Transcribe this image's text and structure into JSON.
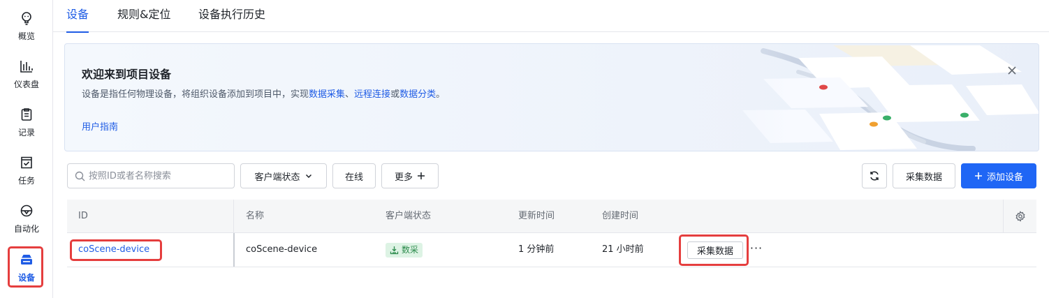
{
  "sidebar": {
    "items": [
      {
        "label": "概览",
        "icon": "lightbulb-icon"
      },
      {
        "label": "仪表盘",
        "icon": "bar-chart-icon"
      },
      {
        "label": "记录",
        "icon": "clipboard-icon"
      },
      {
        "label": "任务",
        "icon": "task-check-icon"
      },
      {
        "label": "自动化",
        "icon": "automation-icon"
      },
      {
        "label": "设备",
        "icon": "device-icon",
        "active": true
      }
    ]
  },
  "tabs": [
    {
      "label": "设备",
      "active": true
    },
    {
      "label": "规则&定位"
    },
    {
      "label": "设备执行历史"
    }
  ],
  "banner": {
    "title": "欢迎来到项目设备",
    "desc_prefix": "设备是指任何物理设备，将组织设备添加到项目中，实现",
    "link_data_collect": "数据采集",
    "sep1": "、",
    "link_remote": "远程连接",
    "sep2": "或",
    "link_classify": "数据分类",
    "desc_suffix": "。",
    "guide": "用户指南",
    "close_icon": "close-icon"
  },
  "toolbar": {
    "search_placeholder": "按照ID或者名称搜索",
    "client_status": "客户端状态",
    "online": "在线",
    "more": "更多",
    "refresh_icon": "refresh-icon",
    "collect": "采集数据",
    "add_device": "添加设备"
  },
  "table": {
    "columns": [
      "ID",
      "名称",
      "客户端状态",
      "更新时间",
      "创建时间"
    ],
    "rows": [
      {
        "id": "coScene-device",
        "name": "coScene-device",
        "status": "数采",
        "updated": "1 分钟前",
        "created": "21 小时前",
        "action": "采集数据",
        "more": "···"
      }
    ]
  },
  "colors": {
    "accent": "#1f5ce5",
    "primary_button": "#1f66f5",
    "highlight": "#e53e3e",
    "status_tag_bg": "#ddf3e4",
    "status_tag_text": "#2b8a4b"
  }
}
